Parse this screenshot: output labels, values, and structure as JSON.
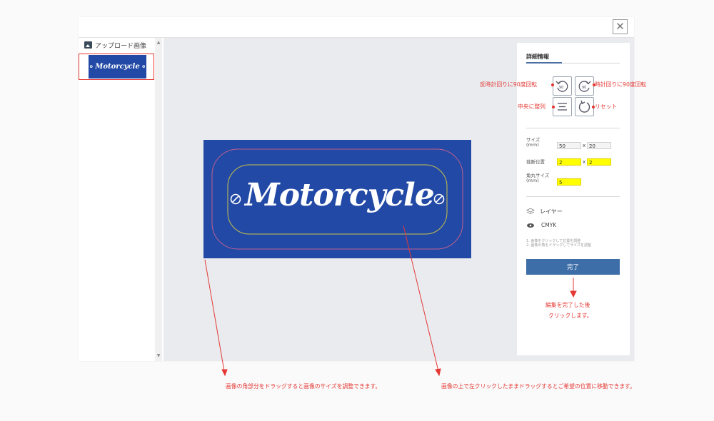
{
  "left_panel": {
    "header": "アップロード画像"
  },
  "thumbnail_text": "Motorcycle",
  "plate": {
    "text": "Motorcycle",
    "color": "#2249a5"
  },
  "detail": {
    "title": "詳細情報",
    "rotate_ccw_value": "90",
    "rotate_cw_value": "90",
    "size_label": "サイズ\n(mm)",
    "size_w": "50",
    "size_h": "20",
    "crop_label": "裁断位置",
    "crop_x": "2",
    "crop_y": "2",
    "corner_label": "角丸サイズ\n(mm)",
    "corner_value": "5",
    "x_sep": "x",
    "layer_label": "レイヤー",
    "cmyk_label": "CMYK",
    "hint_1": "1. 画像をクリックして位置を調整",
    "hint_2": "2. 画像の角をドラッグしてサイズを調整",
    "done_label": "完了"
  },
  "annotations": {
    "rotate_ccw": "反時計回りに90度回転",
    "rotate_cw": "時計回りに90度回転",
    "center": "中央に整列",
    "reset": "リセット",
    "done_note_1": "編集を完了した後",
    "done_note_2": "クリックします。",
    "corner_drag": "画像の角部分をドラッグすると画像のサイズを調整できます。",
    "move_drag": "画像の上で左クリックしたままドラッグするとご希望の位置に移動できます。"
  },
  "colors": {
    "accent": "#3d6ea8",
    "annotation": "#e53935",
    "highlight": "#ffff00"
  }
}
